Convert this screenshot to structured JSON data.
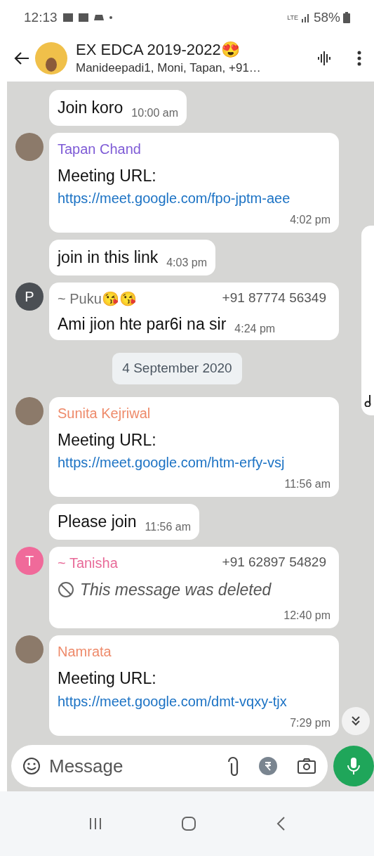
{
  "status_bar": {
    "time": "12:13",
    "network": "LTE",
    "battery": "58%"
  },
  "header": {
    "title": "EX EDCA 2019-2022😍",
    "subtitle": "Manideepadi1, Moni, Tapan, +91…"
  },
  "messages": [
    {
      "kind": "text",
      "text": "Join koro",
      "time": "10:00 am"
    },
    {
      "kind": "link",
      "avatar": {
        "kind": "photo"
      },
      "sender": "Tapan Chand",
      "color": "#7e5bd6",
      "text": "Meeting URL:",
      "link": "https://meet.google.com/fpo-jptm-aee",
      "time": "4:02 pm"
    },
    {
      "kind": "text",
      "text": "join in this link",
      "time": "4:03 pm"
    },
    {
      "kind": "text",
      "avatar": {
        "kind": "letter",
        "letter": "P",
        "color": "#4b4f54"
      },
      "sender": "~ Puku😘😘",
      "color": "#707070",
      "phone": "+91 87774 56349",
      "text": "Ami jion hte par6i na sir",
      "time": "4:24 pm"
    },
    {
      "kind": "date",
      "text": "4 September 2020"
    },
    {
      "kind": "link",
      "avatar": {
        "kind": "photo"
      },
      "sender": "Sunita Kejriwal",
      "color": "#ee8a6a",
      "text": "Meeting URL:",
      "link": "https://meet.google.com/htm-erfy-vsj",
      "time": "11:56 am"
    },
    {
      "kind": "text",
      "text": "Please join",
      "time": "11:56 am"
    },
    {
      "kind": "deleted",
      "avatar": {
        "kind": "letter",
        "letter": "T",
        "color": "#f06a9a"
      },
      "sender": "~ Tanisha",
      "color": "#e86a98",
      "phone": "+91 62897 54829",
      "text": "This message was deleted",
      "time": "12:40 pm"
    },
    {
      "kind": "link",
      "avatar": {
        "kind": "photo"
      },
      "sender": "Namrata",
      "color": "#ee8a6a",
      "text": "Meeting URL:",
      "link": "https://meet.google.com/dmt-vqxy-tjx",
      "time": "7:29 pm"
    }
  ],
  "composer": {
    "placeholder": "Message"
  }
}
